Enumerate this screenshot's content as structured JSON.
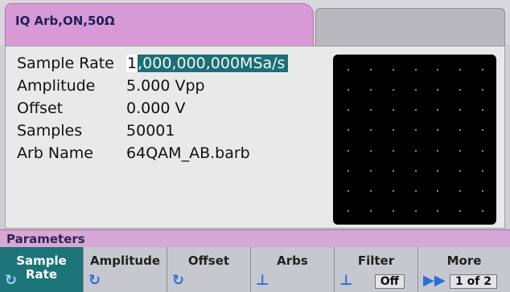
{
  "header": {
    "title": "IQ Arb,ON,50Ω"
  },
  "params": [
    {
      "label": "Sample Rate",
      "value_cursor": "1",
      "value_rest": ",000,000,000MSa/s",
      "editing": true
    },
    {
      "label": "Amplitude",
      "value": "5.000 Vpp"
    },
    {
      "label": "Offset",
      "value": "0.000 V"
    },
    {
      "label": "Samples",
      "value": "50001"
    },
    {
      "label": "Arb Name",
      "value": "64QAM_AB.barb"
    }
  ],
  "parameters_bar": {
    "title": "Parameters"
  },
  "softkeys": [
    {
      "line1": "Sample",
      "line2": "Rate",
      "icon": "rotary-knob-icon",
      "active": true
    },
    {
      "line1": "Amplitude",
      "icon": "rotary-knob-icon"
    },
    {
      "line1": "Offset",
      "icon": "rotary-knob-icon"
    },
    {
      "line1": "Arbs",
      "icon": "submenu-down-icon"
    },
    {
      "line1": "Filter",
      "sub": "Off",
      "icon": "submenu-down-icon"
    },
    {
      "line1": "More",
      "sub": "1 of 2",
      "icon": "next-page-icon"
    }
  ],
  "preview": {
    "grid_cols": 7,
    "grid_rows": 8
  }
}
